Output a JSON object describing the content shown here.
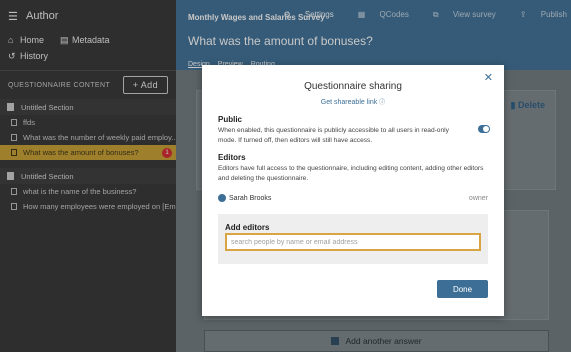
{
  "sidebar": {
    "app_title": "Author",
    "app_icon": "hamburger-sliders-icon",
    "nav": [
      {
        "label": "Home",
        "icon": "home-icon"
      },
      {
        "label": "Metadata",
        "icon": "list-icon"
      },
      {
        "label": "History",
        "icon": "history-icon"
      }
    ],
    "content_header": "QUESTIONNAIRE CONTENT",
    "add_label": "+ Add",
    "sections": [
      {
        "title": "Untitled Section",
        "pages": [
          {
            "label": "ffds"
          },
          {
            "label": "What was the number of weekly paid employ..."
          },
          {
            "label": "What was the amount of bonuses?",
            "badge": "1"
          }
        ]
      },
      {
        "title": "Untitled Section",
        "pages": [
          {
            "label": "what is the name of the business?"
          },
          {
            "label": "How many employees were employed on [Em..."
          }
        ]
      }
    ]
  },
  "header": {
    "survey_title": "Monthly Wages and Salaries Survey",
    "actions": [
      "Settings",
      "QCodes",
      "View survey",
      "Publish"
    ],
    "page_title": "What was the amount of bonuses?",
    "tabs": [
      "Design",
      "Preview",
      "Routing"
    ]
  },
  "background": {
    "delete_label": "Delete",
    "add_another_answer": "Add another answer"
  },
  "modal": {
    "title": "Questionnaire sharing",
    "share_link": "Get shareable link",
    "public_heading": "Public",
    "public_text": "When enabled, this questionnaire is publicly accessible to all users in read-only mode. If turned off, then editors will still have access.",
    "public_enabled": true,
    "editors_heading": "Editors",
    "editors_text": "Editors have full access to the questionnaire, including editing content, adding other editors and deleting the questionnaire.",
    "editors": [
      {
        "name": "Sarah Brooks",
        "role": "owner"
      }
    ],
    "add_editors_label": "Add editors",
    "search_placeholder": "search people by name or email address",
    "done_label": "Done"
  },
  "colors": {
    "sidebar_bg": "#333333",
    "header_bg": "#3d6f96",
    "active_page": "#c8a031",
    "badge": "#d7262b",
    "focus_border": "#d9a441",
    "primary_button": "#3d6f96"
  }
}
